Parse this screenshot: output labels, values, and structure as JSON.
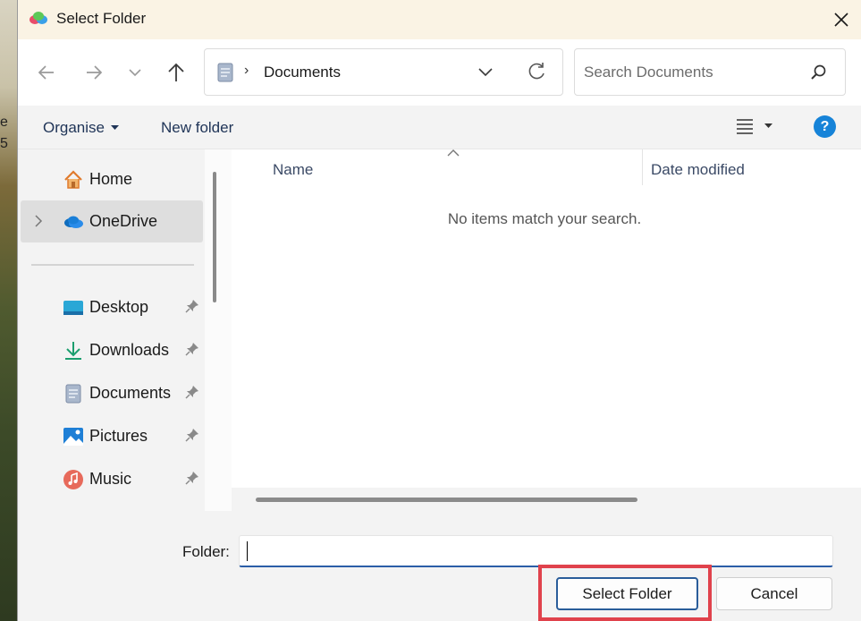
{
  "window": {
    "title": "Select Folder"
  },
  "nav": {
    "address_path": "Documents",
    "search_placeholder": "Search Documents"
  },
  "commandbar": {
    "organise_label": "Organise",
    "new_folder_label": "New folder"
  },
  "sidebar": {
    "items": [
      {
        "label": "Home",
        "icon": "home-icon"
      },
      {
        "label": "OneDrive",
        "icon": "onedrive-icon",
        "selected": true
      },
      {
        "label": "Desktop",
        "icon": "desktop-icon",
        "pinned": true
      },
      {
        "label": "Downloads",
        "icon": "downloads-icon",
        "pinned": true
      },
      {
        "label": "Documents",
        "icon": "documents-icon",
        "pinned": true
      },
      {
        "label": "Pictures",
        "icon": "pictures-icon",
        "pinned": true
      },
      {
        "label": "Music",
        "icon": "music-icon",
        "pinned": true
      }
    ]
  },
  "filelist": {
    "columns": [
      "Name",
      "Date modified"
    ],
    "empty_message": "No items match your search."
  },
  "footer": {
    "folder_label": "Folder:",
    "folder_value": "",
    "select_button": "Select Folder",
    "cancel_button": "Cancel"
  },
  "colors": {
    "accent": "#1683d8",
    "highlight": "#e0424c",
    "titlebar": "#faf3e4"
  },
  "desktop_fragments": [
    "e",
    "5"
  ]
}
